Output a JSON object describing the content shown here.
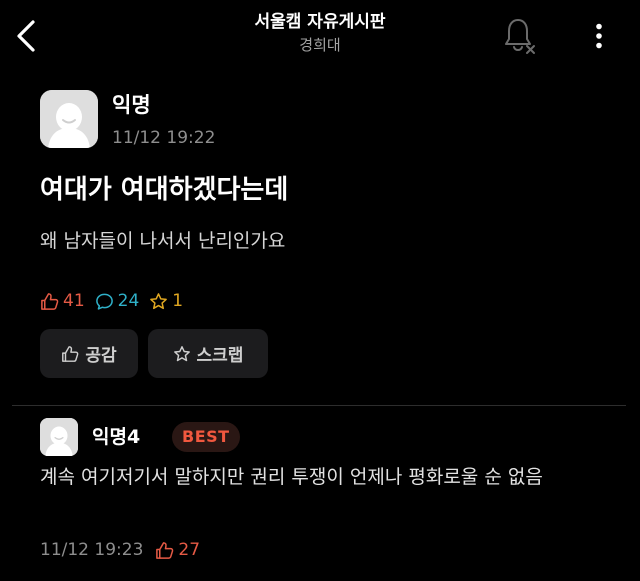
{
  "header": {
    "title": "서울캠 자유게시판",
    "subtitle": "경희대",
    "back_icon": "chevron-left-icon",
    "notification_icon": "bell-off-icon",
    "more_icon": "more-vertical-icon"
  },
  "post": {
    "author": "익명",
    "time": "11/12 19:22",
    "title": "여대가 여대하겠다는데",
    "body": "왜 남자들이 나서서 난리인가요",
    "likes": "41",
    "comments": "24",
    "scraps": "1",
    "like_button_label": "공감",
    "scrap_button_label": "스크랩"
  },
  "comment": {
    "author": "익명4",
    "badge": "BEST",
    "text": "계속 여기저기서 말하지만 권리 투쟁이 언제나 평화로울 순 없음",
    "time": "11/12 19:23",
    "likes": "27"
  },
  "colors": {
    "background": "#000000",
    "like": "#e55a45",
    "comment": "#2fb0c8",
    "scrap": "#e0a721",
    "best_badge_text": "#f1583f"
  }
}
